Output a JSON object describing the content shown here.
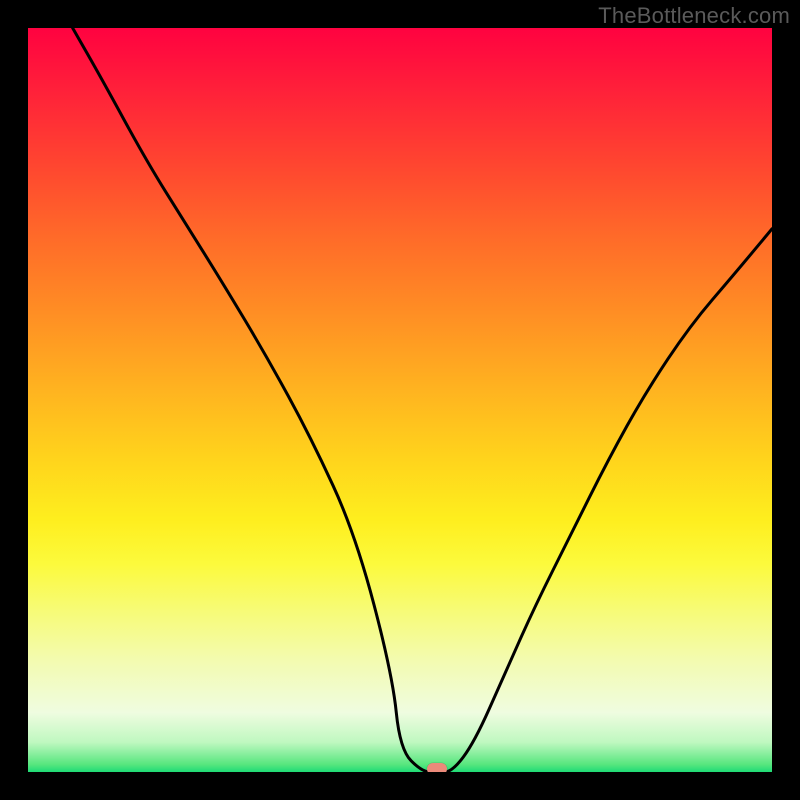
{
  "watermark": "TheBottleneck.com",
  "colors": {
    "page_bg": "#000000",
    "watermark": "#5a5a5a",
    "curve": "#000000",
    "marker": "#eb8a7a",
    "gradient": [
      "#ff0240",
      "#ff1f3a",
      "#ff4430",
      "#ff6a29",
      "#ff8d24",
      "#ffb120",
      "#ffd41c",
      "#feee1e",
      "#fcfa3c",
      "#f7fb74",
      "#f3fbb0",
      "#effce0",
      "#bff8c0",
      "#57e67e",
      "#1edb76"
    ]
  },
  "chart_data": {
    "type": "line",
    "title": "",
    "xlabel": "",
    "ylabel": "",
    "xlim": [
      0,
      100
    ],
    "ylim": [
      0,
      100
    ],
    "grid": false,
    "legend": false,
    "series": [
      {
        "name": "bottleneck-curve",
        "x": [
          6,
          10,
          16,
          21,
          26,
          32,
          38,
          44,
          49,
          50,
          53,
          55,
          57,
          60,
          64,
          68,
          73,
          78,
          83,
          89,
          95,
          100
        ],
        "y": [
          100,
          93,
          82,
          74,
          66,
          56,
          45,
          32,
          13,
          3,
          0,
          0,
          0,
          4,
          13,
          22,
          32,
          42,
          51,
          60,
          67,
          73
        ]
      }
    ],
    "annotations": [
      {
        "name": "optimal-marker",
        "x": 55,
        "y": 0,
        "shape": "capsule",
        "color": "#eb8a7a"
      }
    ],
    "background": "vertical-gradient-heat"
  }
}
